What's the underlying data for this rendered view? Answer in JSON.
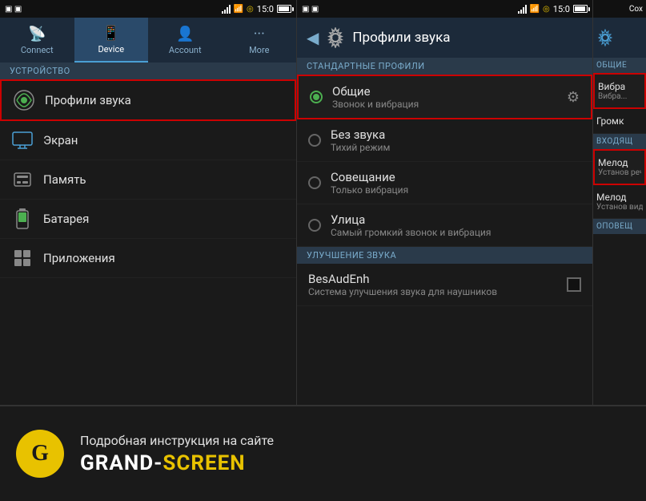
{
  "status": {
    "time": "15:0"
  },
  "panel1": {
    "tabs": [
      {
        "id": "connect",
        "label": "Connect",
        "icon": "📡",
        "active": false
      },
      {
        "id": "device",
        "label": "Device",
        "icon": "📱",
        "active": true
      },
      {
        "id": "account",
        "label": "Account",
        "icon": "👤",
        "active": false
      },
      {
        "id": "more",
        "label": "More",
        "icon": "⋯",
        "active": false
      }
    ],
    "section_header": "УСТРОЙСТВО",
    "items": [
      {
        "id": "sound",
        "label": "Профили звука",
        "icon": "🔊",
        "highlighted": true
      },
      {
        "id": "screen",
        "label": "Экран",
        "icon": "🖥"
      },
      {
        "id": "memory",
        "label": "Память",
        "icon": "💾"
      },
      {
        "id": "battery",
        "label": "Батарея",
        "icon": "🔋"
      },
      {
        "id": "apps",
        "label": "Приложения",
        "icon": "⊞"
      }
    ]
  },
  "panel2": {
    "title": "Профили звука",
    "section_standard": "СТАНДАРТНЫЕ ПРОФИЛИ",
    "section_enhancement": "УЛУЧШЕНИЕ ЗВУКА",
    "profiles": [
      {
        "id": "general",
        "name": "Общие",
        "desc": "Звонок и вибрация",
        "selected": true,
        "highlighted": true
      },
      {
        "id": "silent",
        "name": "Без звука",
        "desc": "Тихий режим",
        "selected": false
      },
      {
        "id": "meeting",
        "name": "Совещание",
        "desc": "Только вибрация",
        "selected": false
      },
      {
        "id": "outdoor",
        "name": "Улица",
        "desc": "Самый громкий звонок и вибрация",
        "selected": false
      }
    ],
    "enhancements": [
      {
        "id": "besaud",
        "name": "BesAudEnh",
        "desc": "Система улучшения звука для наушников",
        "checked": false
      }
    ]
  },
  "panel3": {
    "title": "Сохр",
    "section_general": "ОБЩИЕ",
    "items": [
      {
        "id": "vibra",
        "name": "Вибра",
        "desc": "Вибра...",
        "highlighted": true
      },
      {
        "id": "volume",
        "name": "Громк",
        "desc": ""
      },
      {
        "id": "incoming_section",
        "label": "ВХОДЯЩ"
      },
      {
        "id": "melody1",
        "name": "Мелод",
        "desc": "Установ речевых",
        "highlighted": true
      },
      {
        "id": "melody2",
        "name": "Мелод",
        "desc": "Установ видеовы"
      },
      {
        "id": "notif_section",
        "label": "ОПОВЕЩ"
      }
    ]
  },
  "bottom_bar": {
    "logo": "G",
    "instruction": "Подробная инструкция на сайте",
    "brand_part1": "GRAND-",
    "brand_part2": "SCREEN"
  }
}
